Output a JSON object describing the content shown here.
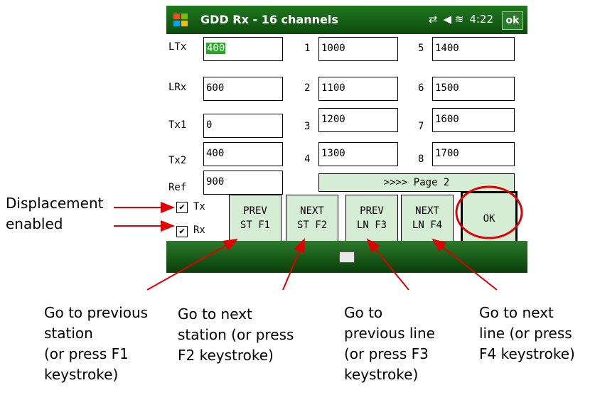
{
  "titlebar": {
    "title": "GDD Rx - 16 channels",
    "time": "4:22",
    "ok": "ok"
  },
  "fields": {
    "LTx": {
      "label": "LTx",
      "value": "400"
    },
    "LRx": {
      "label": "LRx",
      "value": "600"
    },
    "Tx1": {
      "label": "Tx1",
      "value": "0"
    },
    "Tx2": {
      "label": "Tx2",
      "value": "400"
    },
    "Ref": {
      "label": "Ref",
      "value": "900"
    }
  },
  "channels": [
    {
      "n": "1",
      "value": "1000"
    },
    {
      "n": "2",
      "value": "1100"
    },
    {
      "n": "3",
      "value": "1200"
    },
    {
      "n": "4",
      "value": "1300"
    },
    {
      "n": "5",
      "value": "1400"
    },
    {
      "n": "6",
      "value": "1500"
    },
    {
      "n": "7",
      "value": "1600"
    },
    {
      "n": "8",
      "value": "1700"
    }
  ],
  "page_button": ">>>> Page 2",
  "checkboxes": {
    "tx": "Tx",
    "rx": "Rx",
    "checkmark": "✔"
  },
  "nav": {
    "prev_st": {
      "line1": "PREV",
      "line2": "ST F1"
    },
    "next_st": {
      "line1": "NEXT",
      "line2": "ST F2"
    },
    "prev_ln": {
      "line1": "PREV",
      "line2": "LN F3"
    },
    "next_ln": {
      "line1": "NEXT",
      "line2": "LN F4"
    },
    "ok": "OK"
  },
  "annotations": {
    "displacement": [
      "Displacement",
      "enabled"
    ],
    "prev_station": [
      "Go to previous",
      "station",
      "(or press F1",
      "keystroke)"
    ],
    "next_station": [
      "Go to next",
      "station (or press",
      "F2 keystroke)"
    ],
    "prev_line": [
      "Go to",
      "previous line",
      "(or press F3",
      "keystroke)"
    ],
    "next_line": [
      "Go to next",
      "line (or press",
      "F4 keystroke)"
    ]
  },
  "colors": {
    "titlebar": "#1f7a1f",
    "button_fill": "#d5ecd5",
    "selection": "#22aa22",
    "annotation": "#e00000"
  }
}
